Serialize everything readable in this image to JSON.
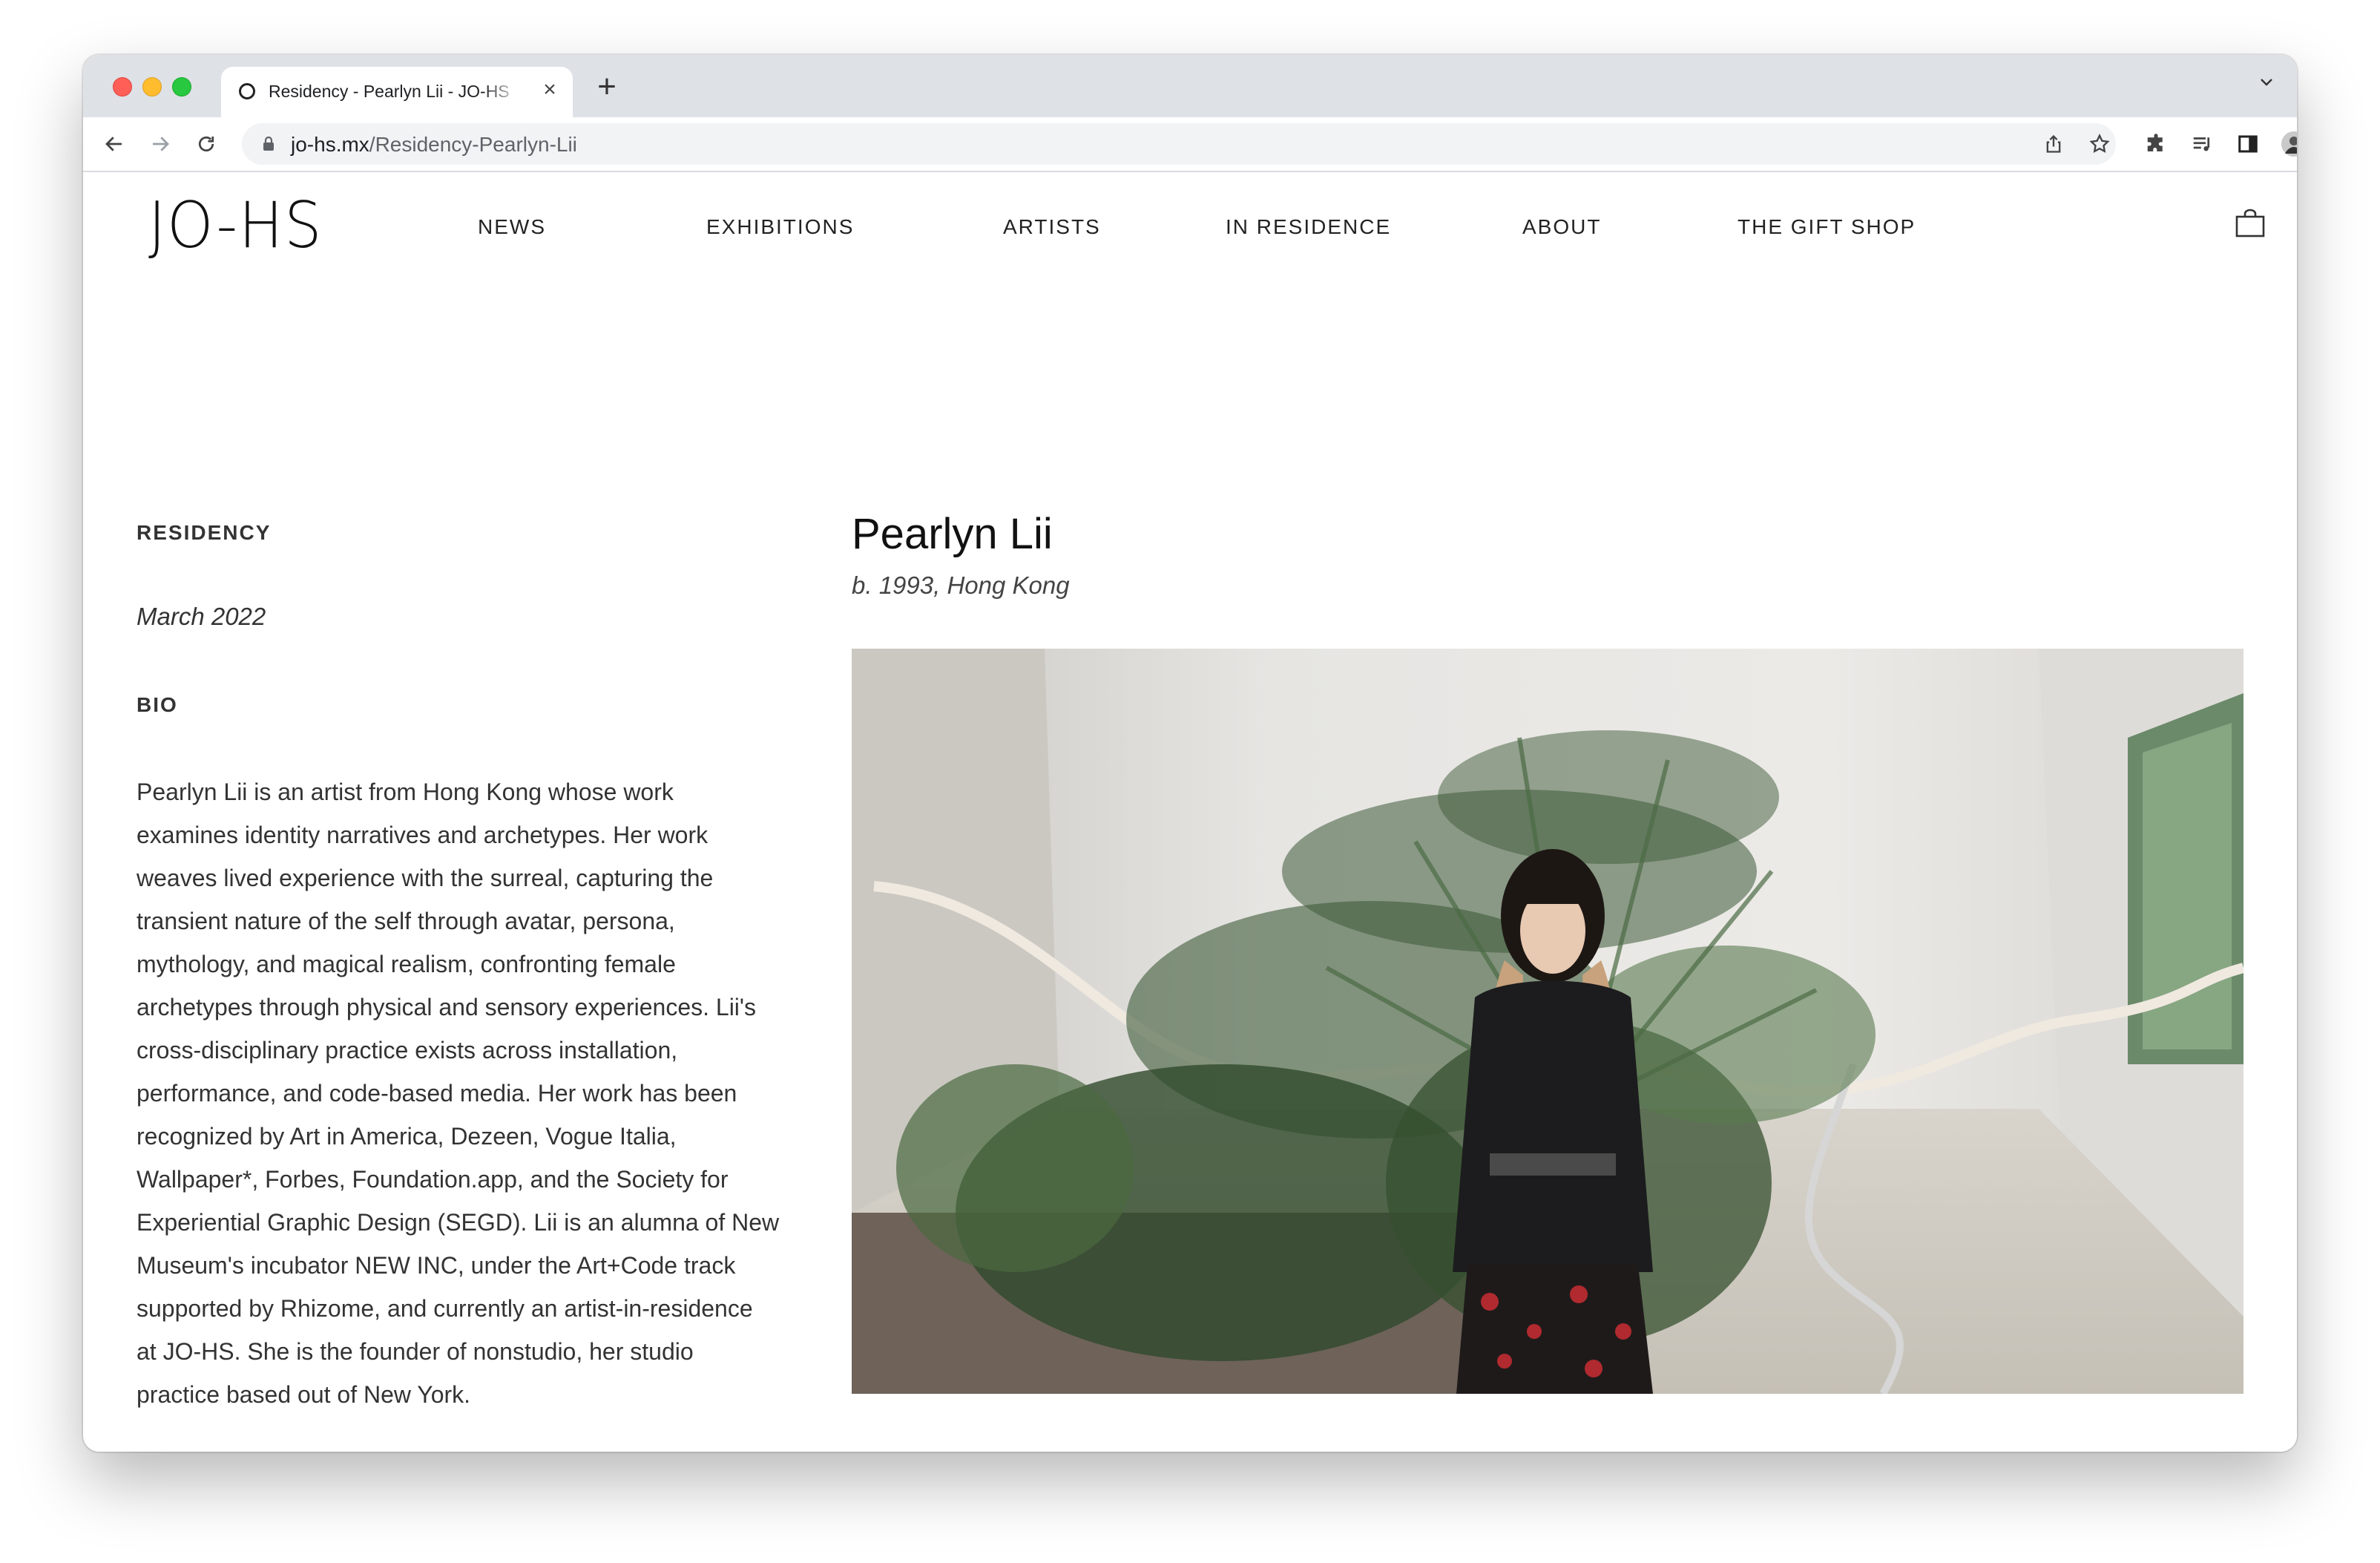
{
  "browser": {
    "tab_title": "Residency - Pearlyn Lii - JO-HS",
    "url_domain": "jo-hs.mx",
    "url_path": "/Residency-Pearlyn-Lii"
  },
  "site": {
    "logo": "JO-HS",
    "nav": [
      "NEWS",
      "EXHIBITIONS",
      "ARTISTS",
      "IN RESIDENCE",
      "ABOUT",
      "THE GIFT SHOP"
    ]
  },
  "sidebar": {
    "residency_label": "RESIDENCY",
    "date": "March 2022",
    "bio_label": "BIO",
    "bio_text": "Pearlyn Lii  is an artist from Hong Kong whose work\nexamines identity narratives and archetypes. Her work\nweaves lived experience with the surreal, capturing the\ntransient nature of the self through avatar, persona,\nmythology, and magical realism, confronting female\narchetypes through physical and sensory experiences. Lii's\ncross-disciplinary practice exists across installation,\nperformance, and code-based media. Her work has been\nrecognized by Art in America, Dezeen, Vogue Italia,\nWallpaper*, Forbes, Foundation.app, and the Society for\nExperiential Graphic Design (SEGD). Lii is an alumna of New\nMuseum's incubator NEW INC, under the Art+Code track\nsupported by Rhizome, and currently an artist-in-residence\nat JO-HS. She is the founder of nonstudio, her studio\npractice based out of New York."
  },
  "main": {
    "artist_name": "Pearlyn Lii",
    "artist_sub": "b. 1993, Hong Kong"
  },
  "colors": {
    "tabstrip": "#dee1e6",
    "omnibox": "#f1f3f4",
    "text": "#333333"
  }
}
